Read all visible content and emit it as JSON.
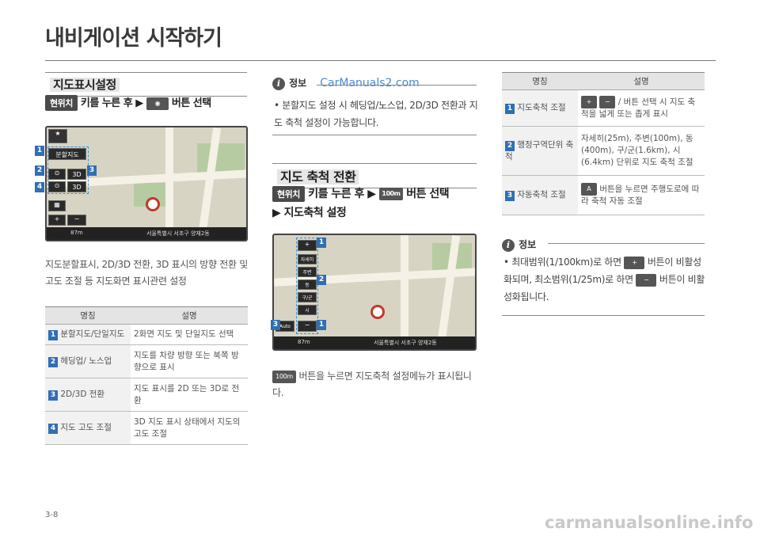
{
  "page_title": "내비게이션 시작하기",
  "section1": {
    "heading": "지도표시설정",
    "key_label": "현위치",
    "instr_pre": "키를 누른 후 ▶",
    "instr_post": "버튼 선택",
    "body": "지도분할표시, 2D/3D 전환, 3D 표시의 방향 전환 및 고도 조절 등 지도화면 표시관련 설정",
    "table": {
      "headers": [
        "명칭",
        "설명"
      ],
      "rows": [
        {
          "num": "1",
          "name": "분할지도/단일지도",
          "desc": "2화면 지도 및 단일지도 선택"
        },
        {
          "num": "2",
          "name": "헤딩업/ 노스업",
          "desc": "지도를 차량 방향 또는 북쪽 방향으로 표시"
        },
        {
          "num": "3",
          "name": "2D/3D 전환",
          "desc": "지도 표시를 2D 또는 3D로 전환"
        },
        {
          "num": "4",
          "name": "지도 고도 조절",
          "desc": "3D 지도 표시 상태에서 지도의 고도 조절"
        }
      ]
    },
    "map": {
      "split_label": "분할지도",
      "btn_3d_1": "3D",
      "btn_3d_2": "3D",
      "distance": "87m",
      "address": "서울특별시 서초구 양재2동",
      "callouts": [
        "1",
        "2",
        "3",
        "4"
      ]
    }
  },
  "info1": {
    "heading": "정보",
    "watermark": "CarManuals2.com",
    "bullet": "분할지도 설정 시 헤딩업/노스업, 2D/3D 전환과 지도 축척 설정이 가능합니다."
  },
  "section2": {
    "heading": "지도 축척 전환",
    "key_label": "현위치",
    "instr_pre": "키를 누른 후 ▶",
    "btn_label": "100m",
    "instr_post": "버튼 선택",
    "sub_instr": "▶ 지도축척 설정",
    "map": {
      "scale_items": [
        "자세히",
        "주변",
        "동",
        "구/군",
        "시"
      ],
      "distance": "87m",
      "address": "서울특별시 서초구 양재2동",
      "auto_label": "Auto",
      "callouts": [
        "1",
        "2",
        "3",
        "1"
      ]
    },
    "note_btn": "100m",
    "note": "버튼을 누르면 지도축척 설정메뉴가 표시됩니다."
  },
  "table2": {
    "headers": [
      "명칭",
      "설명"
    ],
    "rows": [
      {
        "num": "1",
        "name": "지도축척 조절",
        "desc": "/ 버튼 선택 시 지도 축척을 넓게 또는 좁게 표시"
      },
      {
        "num": "2",
        "name": "행정구역단위 축척",
        "desc": "자세히(25m), 주변(100m), 동(400m), 구/군(1.6km), 시(6.4km) 단위로 지도 축척 조절"
      },
      {
        "num": "3",
        "name": "자동축척 조절",
        "desc": "버튼을 누르면 주행도로에 따라 축척 자동 조절"
      }
    ]
  },
  "info2": {
    "heading": "정보",
    "bullet_1": "최대범위(1/100km)로 하면",
    "bullet_2": "버튼이 비활성화되며, 최소범위(1/25m)로 하면",
    "bullet_3": "버튼이 비활성화됩니다."
  },
  "footer": {
    "page_num": "3-8",
    "watermark": "carmanualsonline.info"
  },
  "colors": {
    "accent_blue": "#2f6fb5",
    "dark": "#4a4a4a"
  }
}
